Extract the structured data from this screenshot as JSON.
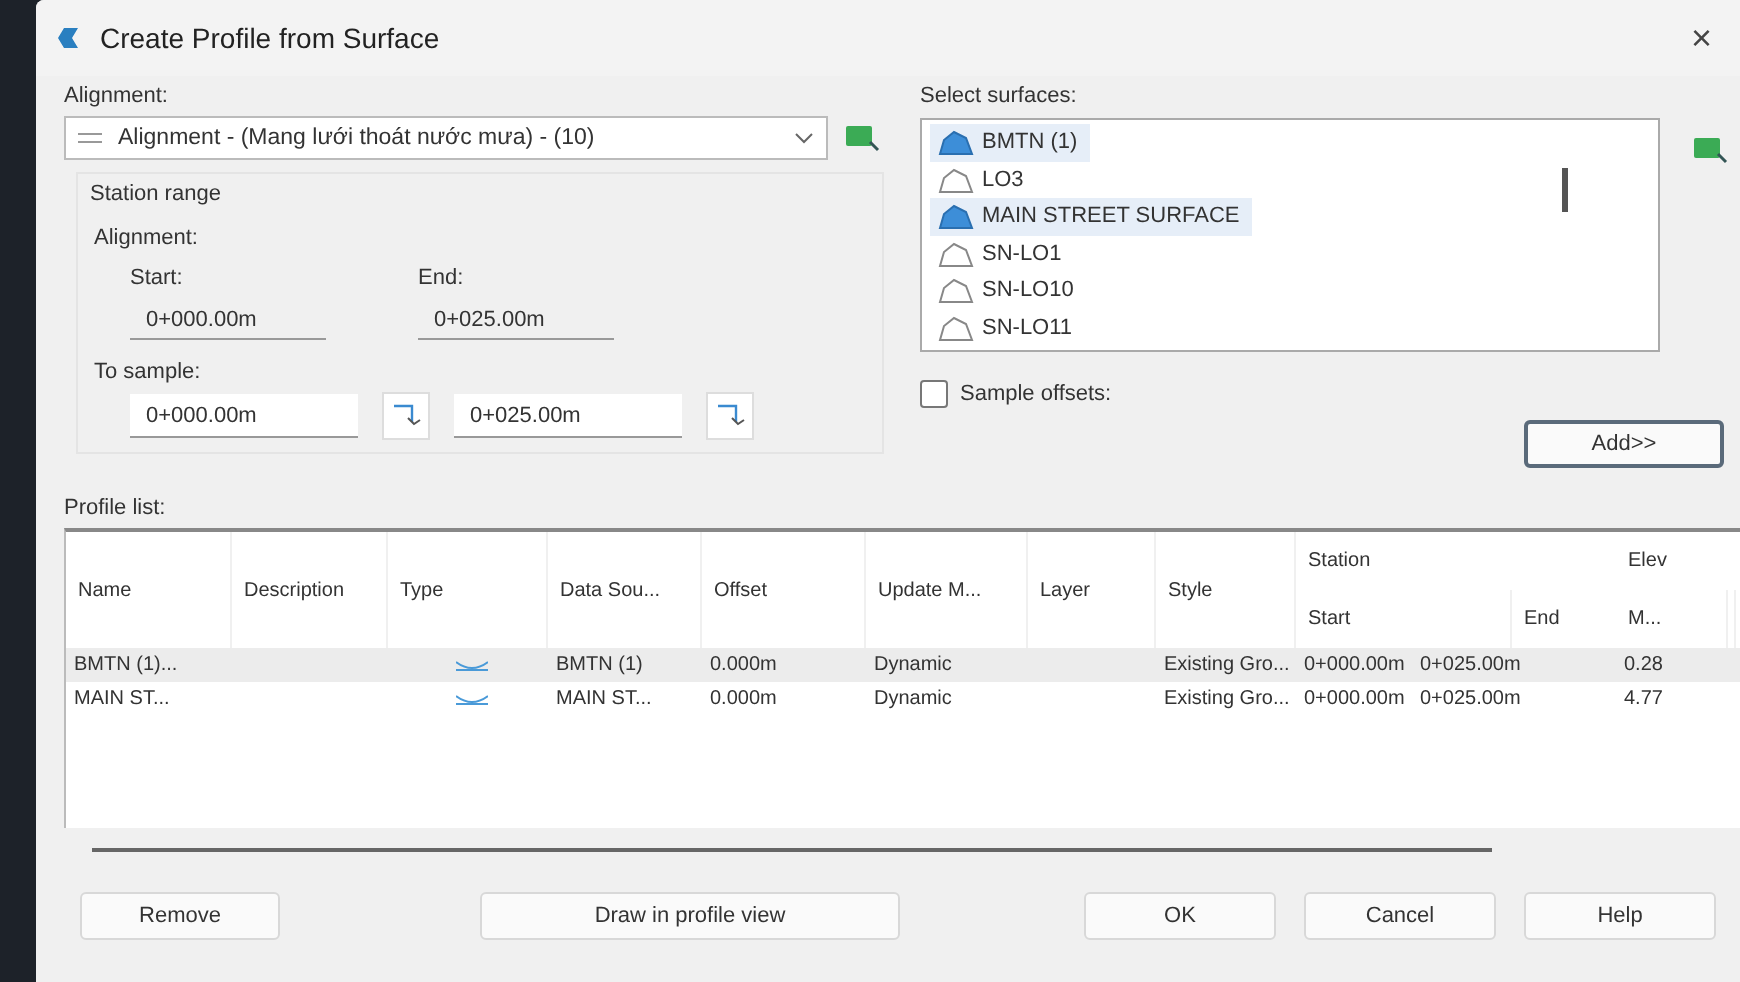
{
  "window": {
    "title": "Create Profile from Surface",
    "close": "×"
  },
  "alignment": {
    "label": "Alignment:",
    "value": "Alignment - (Mang lưới thoát nước mưa) - (10)"
  },
  "station_range": {
    "title": "Station range",
    "alignment_label": "Alignment:",
    "start_label": "Start:",
    "start": "0+000.00m",
    "end_label": "End:",
    "end": "0+025.00m",
    "sample_label": "To sample:",
    "sample_start": "0+000.00m",
    "sample_end": "0+025.00m"
  },
  "surfaces": {
    "label": "Select surfaces:",
    "items": [
      {
        "name": "BMTN (1)",
        "selected": true
      },
      {
        "name": "LO3",
        "selected": false
      },
      {
        "name": "MAIN STREET SURFACE",
        "selected": true
      },
      {
        "name": "SN-LO1",
        "selected": false
      },
      {
        "name": "SN-LO10",
        "selected": false
      },
      {
        "name": "SN-LO11",
        "selected": false
      }
    ]
  },
  "sample_offsets": {
    "label": "Sample offsets:",
    "checked": false
  },
  "add_button": "Add>>",
  "profile_list": {
    "label": "Profile list:",
    "columns": [
      "Name",
      "Description",
      "Type",
      "Data Sou...",
      "Offset",
      "Update M...",
      "Layer",
      "Style"
    ],
    "group_column": {
      "title": "Station",
      "sub": [
        "Start",
        "End"
      ]
    },
    "elev_column": {
      "title": "Elev",
      "sub": "M..."
    },
    "rows": [
      {
        "name": "BMTN (1)...",
        "data_source": "BMTN (1)",
        "offset": "0.000m",
        "update_mode": "Dynamic",
        "style": "Existing Gro...",
        "start": "0+000.00m",
        "end": "0+025.00m",
        "elev": "0.28",
        "selected": true
      },
      {
        "name": "MAIN ST...",
        "data_source": "MAIN ST...",
        "offset": "0.000m",
        "update_mode": "Dynamic",
        "style": "Existing Gro...",
        "start": "0+000.00m",
        "end": "0+025.00m",
        "elev": "4.77",
        "selected": false
      }
    ]
  },
  "buttons": {
    "remove": "Remove",
    "draw": "Draw in profile view",
    "ok": "OK",
    "cancel": "Cancel",
    "help": "Help"
  }
}
